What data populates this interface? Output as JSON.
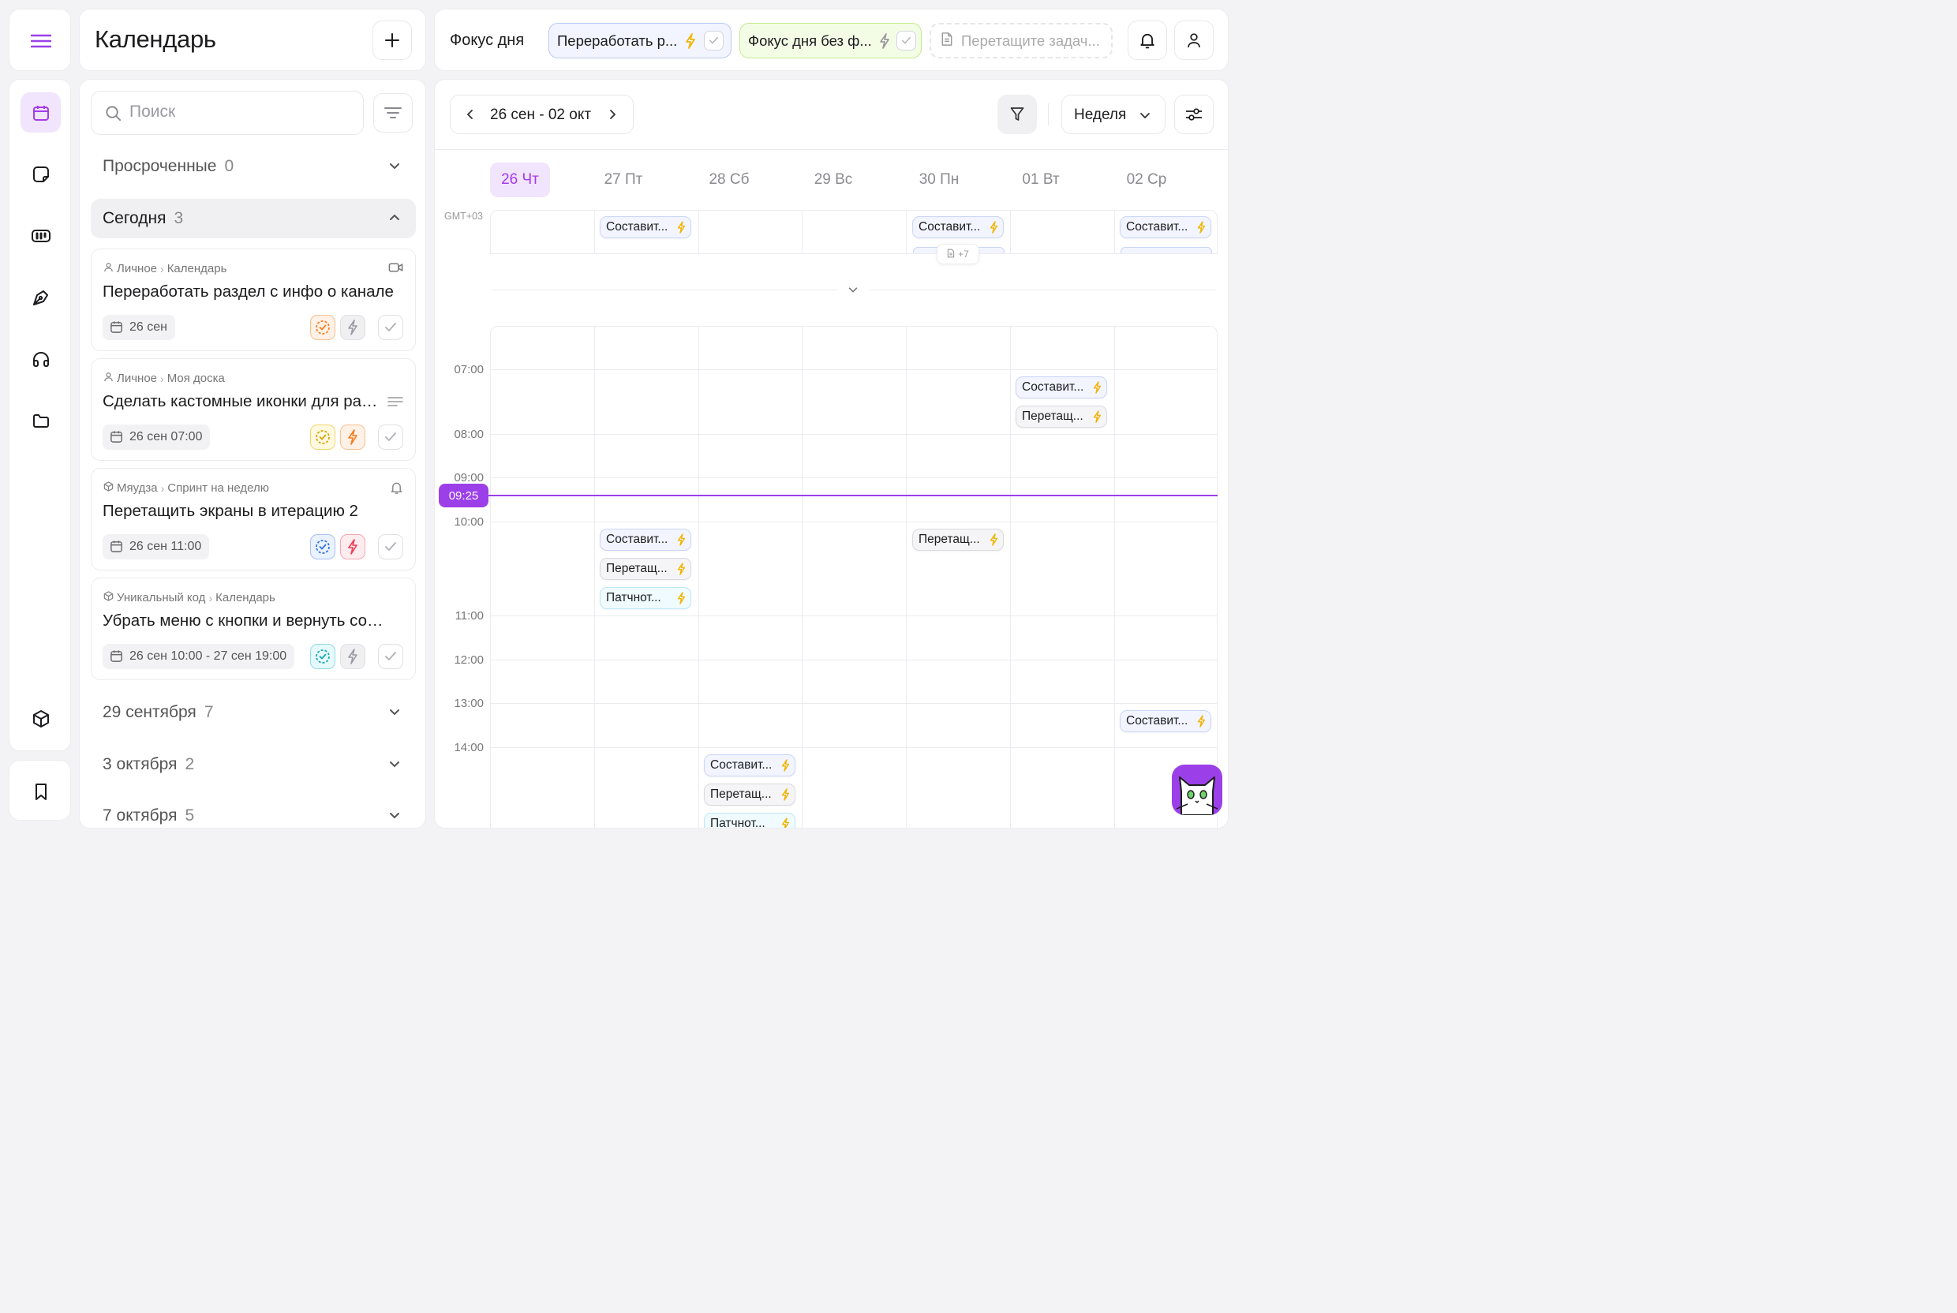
{
  "sidebar": {
    "menu_icon": "hamburger-menu-icon",
    "items": [
      {
        "icon": "calendar-icon",
        "active": true
      },
      {
        "icon": "sticky-note-icon"
      },
      {
        "icon": "kanban-icon"
      },
      {
        "icon": "pen-nib-icon"
      },
      {
        "icon": "headphones-icon"
      },
      {
        "icon": "folder-icon"
      },
      {
        "icon": "cube-icon"
      }
    ],
    "bottom_icon": "bookmark-icon"
  },
  "left": {
    "title": "Календарь",
    "search_placeholder": "Поиск",
    "overdue": {
      "label": "Просроченные",
      "count": "0"
    },
    "today": {
      "label": "Сегодня",
      "count": "3"
    },
    "tasks": [
      {
        "crumb_a": "Личное",
        "crumb_b": "Календарь",
        "title": "Переработать раздел с инфо о канале",
        "date": "26 сен",
        "corner_icon": "video-icon",
        "status_color": "#f57c1f",
        "bolt_color": "#9a9aa0"
      },
      {
        "crumb_a": "Личное",
        "crumb_b": "Моя доска",
        "title": "Сделать кастомные иконки для раздела",
        "date": "26 сен 07:00",
        "corner_icon": "text-lines-icon",
        "status_color": "#e3b10a",
        "bolt_color": "#f57c1f"
      },
      {
        "crumb_a": "Мяудза",
        "crumb_b": "Спринт на неделю",
        "title": "Перетащить экраны в итерацию 2",
        "date": "26 сен 11:00",
        "corner_icon": "bell-icon",
        "status_color": "#2f6fe0",
        "bolt_color": "#ef3a52"
      },
      {
        "crumb_a": "Уникальный код",
        "crumb_b": "Календарь",
        "title": "Убрать меню с кнопки и вернуть со…",
        "date": "26 сен 10:00 - 27 сен 19:00",
        "corner_icon": "",
        "status_color": "#13a6b8",
        "bolt_color": "#9a9aa0"
      }
    ],
    "groups": [
      {
        "label": "29 сентября",
        "count": "7"
      },
      {
        "label": "3 октября",
        "count": "2"
      },
      {
        "label": "7 октября",
        "count": "5"
      }
    ]
  },
  "focus": {
    "label": "Фокус дня",
    "chip1": "Переработать р...",
    "chip2": "Фокус дня без ф...",
    "drop_placeholder": "Перетащите задач..."
  },
  "calendar": {
    "range": "26 сен - 02 окт",
    "view": "Неделя",
    "timezone": "GMT+03",
    "now": "09:25",
    "more_count": "+7",
    "days": [
      "26 Чт",
      "27 Пт",
      "28 Сб",
      "29 Вс",
      "30 Пн",
      "01 Вт",
      "02 Ср"
    ],
    "times": [
      "07:00",
      "08:00",
      "09:00",
      "10:00",
      "11:00",
      "12:00",
      "13:00",
      "14:00"
    ],
    "events": {
      "e1": "Составит...",
      "e2": "Составит...",
      "e3": "Составит...",
      "e4": "Составит...",
      "e5": "Перетащ...",
      "e6": "Составит...",
      "e7": "Перетащ...",
      "e8": "Патчнот...",
      "e9": "Перетащ...",
      "e10": "Составит...",
      "e11": "Составит...",
      "e12": "Перетащ...",
      "e13": "Патчнот..."
    }
  },
  "colors": {
    "accent": "#9b3fe8",
    "now_line": "#9b3fe8",
    "bolt": "#f2b300"
  }
}
